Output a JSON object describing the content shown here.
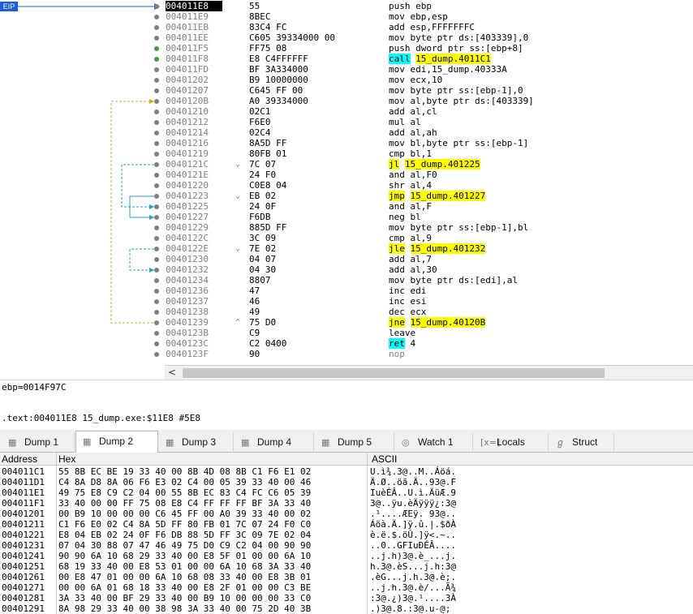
{
  "eip_label": "EIP",
  "disasm": [
    {
      "addr": "004011E8",
      "bytes": "55",
      "dis": "push ebp",
      "dot": "grey",
      "cur": true
    },
    {
      "addr": "004011E9",
      "bytes": "8BEC",
      "dis": "mov ebp,esp",
      "dot": "grey"
    },
    {
      "addr": "004011EB",
      "bytes": "83C4 FC",
      "dis": "add esp,FFFFFFFC",
      "dot": "grey"
    },
    {
      "addr": "004011EE",
      "bytes": "C605 39334000 00",
      "dis": "mov byte ptr ds:[403339],0",
      "dot": "grey"
    },
    {
      "addr": "004011F5",
      "bytes": "FF75 08",
      "dis": "push dword ptr ss:[ebp+8]",
      "dot": "green"
    },
    {
      "addr": "004011F8",
      "bytes": "E8 C4FFFFFF",
      "dis": "call 15_dump.4011C1",
      "dot": "green",
      "hl": "c"
    },
    {
      "addr": "004011FD",
      "bytes": "BF 3A334000",
      "dis": "mov edi,15_dump.40333A",
      "dot": "grey"
    },
    {
      "addr": "00401202",
      "bytes": "B9 10000000",
      "dis": "mov ecx,10",
      "dot": "grey"
    },
    {
      "addr": "00401207",
      "bytes": "C645 FF 00",
      "dis": "mov byte ptr ss:[ebp-1],0",
      "dot": "grey"
    },
    {
      "addr": "0040120B",
      "bytes": "A0 39334000",
      "dis": "mov al,byte ptr ds:[403339]",
      "dot": "grey"
    },
    {
      "addr": "00401210",
      "bytes": "02C1",
      "dis": "add al,cl",
      "dot": "grey"
    },
    {
      "addr": "00401212",
      "bytes": "F6E0",
      "dis": "mul al",
      "dot": "grey"
    },
    {
      "addr": "00401214",
      "bytes": "02C4",
      "dis": "add al,ah",
      "dot": "grey"
    },
    {
      "addr": "00401216",
      "bytes": "8A5D FF",
      "dis": "mov bl,byte ptr ss:[ebp-1]",
      "dot": "grey"
    },
    {
      "addr": "00401219",
      "bytes": "80FB 01",
      "dis": "cmp bl,1",
      "dot": "grey"
    },
    {
      "addr": "0040121C",
      "bytes": "7C 07",
      "dis": "jl 15_dump.401225",
      "dot": "grey",
      "hl": "y",
      "mark": "⌄"
    },
    {
      "addr": "0040121E",
      "bytes": "24 F0",
      "dis": "and al,F0",
      "dot": "grey"
    },
    {
      "addr": "00401220",
      "bytes": "C0E8 04",
      "dis": "shr al,4",
      "dot": "grey"
    },
    {
      "addr": "00401223",
      "bytes": "EB 02",
      "dis": "jmp 15_dump.401227",
      "dot": "grey",
      "hl": "y",
      "mark": "⌄"
    },
    {
      "addr": "00401225",
      "bytes": "24 0F",
      "dis": "and al,F",
      "dot": "grey"
    },
    {
      "addr": "00401227",
      "bytes": "F6DB",
      "dis": "neg bl",
      "dot": "grey"
    },
    {
      "addr": "00401229",
      "bytes": "885D FF",
      "dis": "mov byte ptr ss:[ebp-1],bl",
      "dot": "grey"
    },
    {
      "addr": "0040122C",
      "bytes": "3C 09",
      "dis": "cmp al,9",
      "dot": "grey"
    },
    {
      "addr": "0040122E",
      "bytes": "7E 02",
      "dis": "jle 15_dump.401232",
      "dot": "grey",
      "hl": "y",
      "mark": "⌄"
    },
    {
      "addr": "00401230",
      "bytes": "04 07",
      "dis": "add al,7",
      "dot": "grey"
    },
    {
      "addr": "00401232",
      "bytes": "04 30",
      "dis": "add al,30",
      "dot": "grey"
    },
    {
      "addr": "00401234",
      "bytes": "8807",
      "dis": "mov byte ptr ds:[edi],al",
      "dot": "grey"
    },
    {
      "addr": "00401236",
      "bytes": "47",
      "dis": "inc edi",
      "dot": "grey"
    },
    {
      "addr": "00401237",
      "bytes": "46",
      "dis": "inc esi",
      "dot": "grey"
    },
    {
      "addr": "00401238",
      "bytes": "49",
      "dis": "dec ecx",
      "dot": "grey"
    },
    {
      "addr": "00401239",
      "bytes": "75 D0",
      "dis": "jne 15_dump.40120B",
      "dot": "grey",
      "hl": "y",
      "mark": "⌃"
    },
    {
      "addr": "0040123B",
      "bytes": "C9",
      "dis": "leave",
      "dot": "grey"
    },
    {
      "addr": "0040123C",
      "bytes": "C2 0400",
      "dis": "ret 4",
      "dot": "grey",
      "hl": "c"
    },
    {
      "addr": "0040123F",
      "bytes": "90",
      "dis": "nop",
      "dot": "grey",
      "dim": true
    }
  ],
  "info_line1": "ebp=0014F97C",
  "info_line2": ".text:004011E8 15_dump.exe:$11E8 #5E8",
  "tabs": [
    {
      "label": "Dump 1",
      "icon": "▦"
    },
    {
      "label": "Dump 2",
      "icon": "▦",
      "active": true
    },
    {
      "label": "Dump 3",
      "icon": "▦"
    },
    {
      "label": "Dump 4",
      "icon": "▦"
    },
    {
      "label": "Dump 5",
      "icon": "▦"
    },
    {
      "label": "Watch 1",
      "icon": "◎"
    },
    {
      "label": "Locals",
      "icon": "[x=]"
    },
    {
      "label": "Struct",
      "icon": "ℊ"
    }
  ],
  "dump_headers": {
    "address": "Address",
    "hex": "Hex",
    "ascii": "ASCII"
  },
  "dump": [
    {
      "addr": "004011C1",
      "hex": "55 8B EC BE 19 33 40 00 8B 4D 08 8B C1 F6 E1 02",
      "ascii": "U.ì¾.3@..M..Áöá."
    },
    {
      "addr": "004011D1",
      "hex": "C4 8A D8 8A 06 F6 E3 02 C4 00 05 39 33 40 00 46",
      "ascii": "Ä.Ø..öã.Ä..93@.F"
    },
    {
      "addr": "004011E1",
      "hex": "49 75 E8 C9 C2 04 00 55 8B EC 83 C4 FC C6 05 39",
      "ascii": "IuèÉÂ..U.ì.ÄüÆ.9"
    },
    {
      "addr": "004011F1",
      "hex": "33 40 00 00 FF 75 08 E8 C4 FF FF FF BF 3A 33 40",
      "ascii": "3@..ÿu.èÄÿÿÿ¿:3@"
    },
    {
      "addr": "00401201",
      "hex": "00 B9 10 00 00 00 C6 45 FF 00 A0 39 33 40 00 02",
      "ascii": ".¹....ÆEÿ. 93@.."
    },
    {
      "addr": "00401211",
      "hex": "C1 F6 E0 02 C4 8A 5D FF 80 FB 01 7C 07 24 F0 C0",
      "ascii": "Áöà.Ä.]ÿ.û.|.$ðÀ"
    },
    {
      "addr": "00401221",
      "hex": "E8 04 EB 02 24 0F F6 DB 88 5D FF 3C 09 7E 02 04",
      "ascii": "è.ë.$.öÛ.]ÿ<.~.."
    },
    {
      "addr": "00401231",
      "hex": "07 04 30 88 07 47 46 49 75 D0 C9 C2 04 00 90 90",
      "ascii": "..0..GFIuÐÉÂ...."
    },
    {
      "addr": "00401241",
      "hex": "90 90 6A 10 68 29 33 40 00 E8 5F 01 00 00 6A 10",
      "ascii": "..j.h)3@.è_...j."
    },
    {
      "addr": "00401251",
      "hex": "68 19 33 40 00 E8 53 01 00 00 6A 10 68 3A 33 40",
      "ascii": "h.3@.èS...j.h:3@"
    },
    {
      "addr": "00401261",
      "hex": "00 E8 47 01 00 00 6A 10 68 08 33 40 00 E8 3B 01",
      "ascii": ".èG...j.h.3@.è;."
    },
    {
      "addr": "00401271",
      "hex": "00 00 6A 01 68 18 33 40 00 E8 2F 01 00 00 C3 BE",
      "ascii": "..j.h.3@.è/...Ã¾"
    },
    {
      "addr": "00401281",
      "hex": "3A 33 40 00 BF 29 33 40 00 B9 10 00 00 00 33 C0",
      "ascii": ":3@.¿)3@.¹....3À"
    },
    {
      "addr": "00401291",
      "hex": "8A 98 29 33 40 00 38 98 3A 33 40 00 75 2D 40 3B",
      "ascii": ".)3@.8.:3@.u-@;"
    }
  ]
}
